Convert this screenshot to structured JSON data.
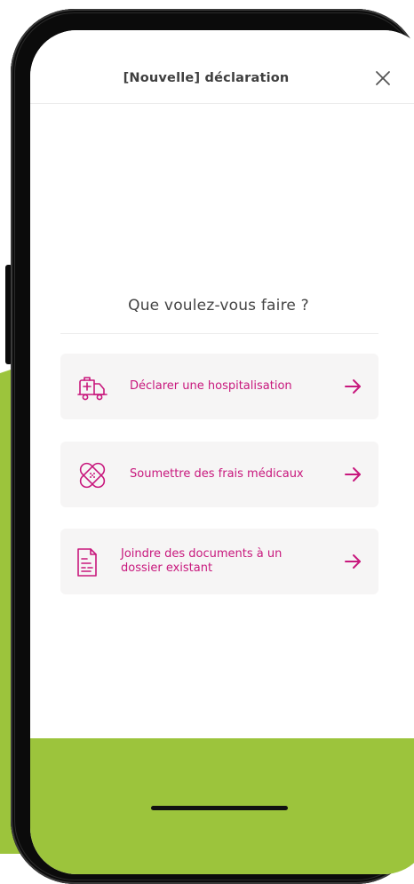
{
  "colors": {
    "accent": "#c8187d",
    "green": "#9cc43c",
    "title_text": "#3f3f3f",
    "card_bg": "#f6f5f5"
  },
  "header": {
    "title": "[Nouvelle] déclaration",
    "close_icon": "close-icon"
  },
  "main": {
    "question": "Que voulez-vous faire ?",
    "options": [
      {
        "label": "Déclarer une hospitalisation",
        "icon": "ambulance-icon",
        "action_icon": "arrow-right-icon"
      },
      {
        "label": "Soumettre des frais médicaux",
        "icon": "bandage-icon",
        "action_icon": "arrow-right-icon"
      },
      {
        "label": "Joindre des documents à un dossier existant",
        "icon": "document-icon",
        "action_icon": "arrow-right-icon"
      }
    ]
  }
}
